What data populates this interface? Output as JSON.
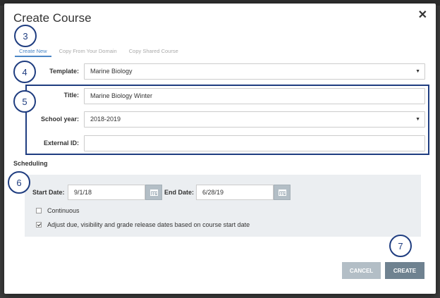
{
  "dialog": {
    "title": "Create Course"
  },
  "tabs": [
    {
      "label": "Create New",
      "active": true
    },
    {
      "label": "Copy From Your Domain",
      "active": false
    },
    {
      "label": "Copy Shared Course",
      "active": false
    }
  ],
  "form": {
    "template": {
      "label": "Template:",
      "value": "Marine Biology"
    },
    "title": {
      "label": "Title:",
      "value": "Marine Biology Winter"
    },
    "school_year": {
      "label": "School year:",
      "value": "2018-2019"
    },
    "external_id": {
      "label": "External ID:",
      "value": ""
    }
  },
  "scheduling": {
    "section_title": "Scheduling",
    "start_date": {
      "label": "Start Date:",
      "value": "9/1/18"
    },
    "end_date": {
      "label": "End Date:",
      "value": "6/28/19"
    },
    "continuous": {
      "label": "Continuous",
      "checked": false
    },
    "adjust_dates": {
      "label": "Adjust due, visibility and grade release dates based on course start date",
      "checked": true
    }
  },
  "buttons": {
    "cancel_label": "CANCEL",
    "create_label": "CREATE"
  },
  "steps": [
    "3",
    "4",
    "5",
    "6",
    "7"
  ],
  "icons": {
    "close": "close-icon",
    "dropdown": "chevron-down-icon",
    "calendar": "calendar-icon"
  },
  "colors": {
    "accent": "#4a86c5",
    "annotation": "#1f3d80",
    "create_button": "#6f8290",
    "cancel_button": "#b3bec6"
  }
}
